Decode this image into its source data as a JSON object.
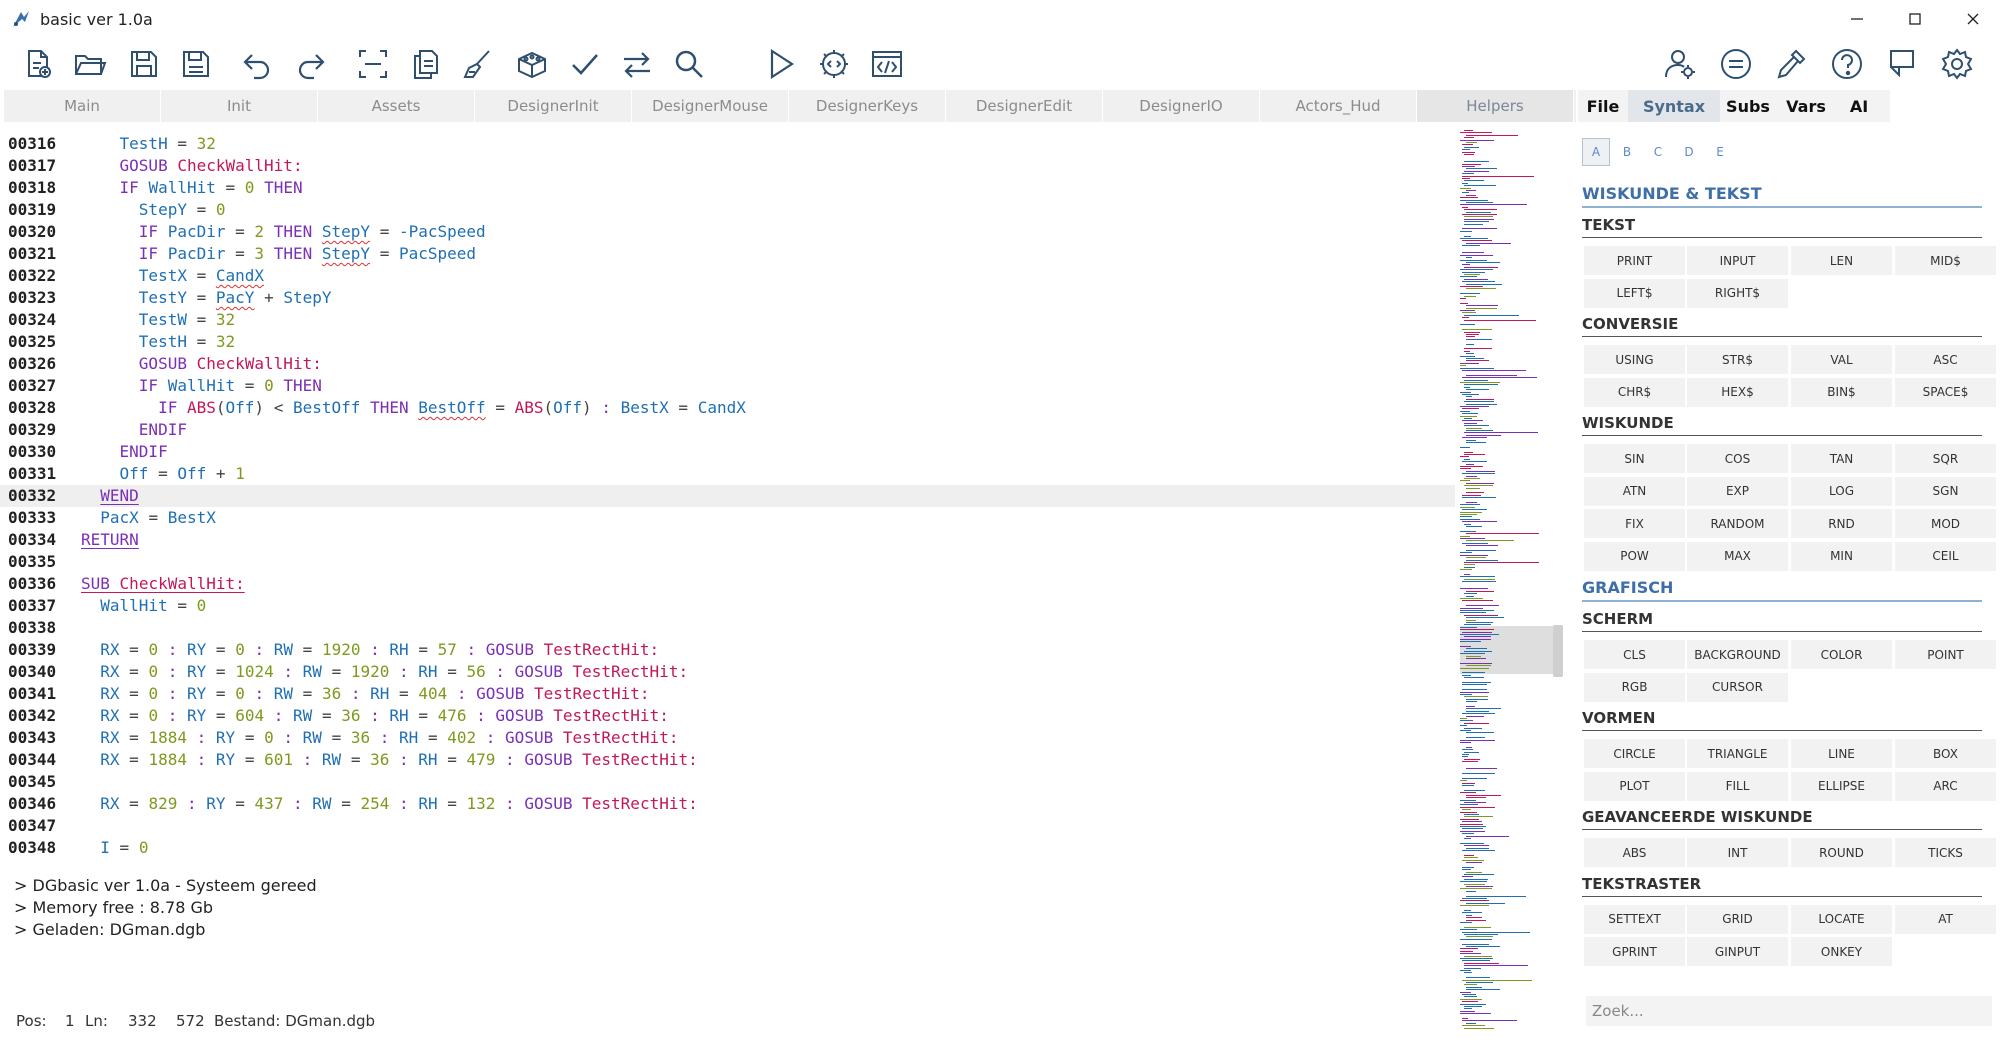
{
  "window": {
    "title": "basic ver 1.0a",
    "controls": [
      "minimize-icon",
      "maximize-icon",
      "close-icon"
    ]
  },
  "toolbar": {
    "buttons": [
      "new-file-icon",
      "open-folder-icon",
      "save-icon",
      "save-as-icon",
      "undo-icon",
      "redo-icon",
      "select-all-icon",
      "copy-icon",
      "brush-icon",
      "package-icon",
      "check-icon",
      "swap-icon",
      "search-icon",
      "run-icon",
      "compile-icon",
      "code-window-icon"
    ],
    "right_buttons": [
      "user-settings-icon",
      "equals-icon",
      "eyedropper-icon",
      "help-icon",
      "pin-icon",
      "gear-icon"
    ]
  },
  "tabs": [
    "Main",
    "Init",
    "Assets",
    "DesignerInit",
    "DesignerMouse",
    "DesignerKeys",
    "DesignerEdit",
    "DesignerIO",
    "Actors_Hud",
    "Helpers"
  ],
  "active_tab": "Helpers",
  "code": {
    "current_line": "00332",
    "lines": [
      {
        "n": "00316",
        "html": "    <span class='var'>TestH</span> <span class='op'>=</span> <span class='num'>32</span>"
      },
      {
        "n": "00317",
        "html": "    <span class='kw'>GOSUB</span> <span class='lbl'>CheckWallHit:</span>"
      },
      {
        "n": "00318",
        "html": "    <span class='kw'>IF</span> <span class='var'>WallHit</span> <span class='op'>=</span> <span class='num'>0</span> <span class='kw'>THEN</span>"
      },
      {
        "n": "00319",
        "html": "      <span class='var'>StepY</span> <span class='op'>=</span> <span class='num'>0</span>"
      },
      {
        "n": "00320",
        "html": "      <span class='kw'>IF</span> <span class='var'>PacDir</span> <span class='op'>=</span> <span class='num'>2</span> <span class='kw'>THEN</span> <span class='var sq'>StepY</span> <span class='op'>=</span> <span class='var'>-PacSpeed</span>"
      },
      {
        "n": "00321",
        "html": "      <span class='kw'>IF</span> <span class='var'>PacDir</span> <span class='op'>=</span> <span class='num'>3</span> <span class='kw'>THEN</span> <span class='var sq'>StepY</span> <span class='op'>=</span> <span class='var'>PacSpeed</span>"
      },
      {
        "n": "00322",
        "html": "      <span class='var'>TestX</span> <span class='op'>=</span> <span class='var sq'>CandX</span>"
      },
      {
        "n": "00323",
        "html": "      <span class='var'>TestY</span> <span class='op'>=</span> <span class='var sq'>PacY</span> <span class='op'>+</span> <span class='var'>StepY</span>"
      },
      {
        "n": "00324",
        "html": "      <span class='var'>TestW</span> <span class='op'>=</span> <span class='num'>32</span>"
      },
      {
        "n": "00325",
        "html": "      <span class='var'>TestH</span> <span class='op'>=</span> <span class='num'>32</span>"
      },
      {
        "n": "00326",
        "html": "      <span class='kw'>GOSUB</span> <span class='lbl'>CheckWallHit:</span>"
      },
      {
        "n": "00327",
        "html": "      <span class='kw'>IF</span> <span class='var'>WallHit</span> <span class='op'>=</span> <span class='num'>0</span> <span class='kw'>THEN</span>"
      },
      {
        "n": "00328",
        "html": "        <span class='kw'>IF</span> <span class='fn'>ABS</span><span class='op'>(</span><span class='var'>Off</span><span class='op'>)</span> <span class='op'>&lt;</span> <span class='var'>BestOff</span> <span class='kw'>THEN</span> <span class='var sq'>BestOff</span> <span class='op'>=</span> <span class='fn'>ABS</span><span class='op'>(</span><span class='var'>Off</span><span class='op'>)</span> <span class='kw'>:</span> <span class='var'>BestX</span> <span class='op'>=</span> <span class='var'>CandX</span>"
      },
      {
        "n": "00329",
        "html": "      <span class='kw'>ENDIF</span>"
      },
      {
        "n": "00330",
        "html": "    <span class='kw'>ENDIF</span>"
      },
      {
        "n": "00331",
        "html": "    <span class='var'>Off</span> <span class='op'>=</span> <span class='var'>Off</span> <span class='op'>+</span> <span class='num'>1</span>"
      },
      {
        "n": "00332",
        "html": "  <span class='kw ulk'>WEND</span>"
      },
      {
        "n": "00333",
        "html": "  <span class='var'>PacX</span> <span class='op'>=</span> <span class='var'>BestX</span>"
      },
      {
        "n": "00334",
        "html": "<span class='kw ulk'>RETURN</span>"
      },
      {
        "n": "00335",
        "html": ""
      },
      {
        "n": "00336",
        "html": "<span class='kw ul'>SUB</span><span class='ul'> </span><span class='lbl ul'>CheckWallHit:</span>"
      },
      {
        "n": "00337",
        "html": "  <span class='var'>WallHit</span> <span class='op'>=</span> <span class='num'>0</span>"
      },
      {
        "n": "00338",
        "html": ""
      },
      {
        "n": "00339",
        "html": "  <span class='var'>RX</span> <span class='op'>=</span> <span class='num'>0</span> <span class='kw'>:</span> <span class='var'>RY</span> <span class='op'>=</span> <span class='num'>0</span> <span class='kw'>:</span> <span class='var'>RW</span> <span class='op'>=</span> <span class='num'>1920</span> <span class='kw'>:</span> <span class='var'>RH</span> <span class='op'>=</span> <span class='num'>57</span> <span class='kw'>:</span> <span class='kw'>GOSUB</span> <span class='lbl'>TestRectHit:</span>"
      },
      {
        "n": "00340",
        "html": "  <span class='var'>RX</span> <span class='op'>=</span> <span class='num'>0</span> <span class='kw'>:</span> <span class='var'>RY</span> <span class='op'>=</span> <span class='num'>1024</span> <span class='kw'>:</span> <span class='var'>RW</span> <span class='op'>=</span> <span class='num'>1920</span> <span class='kw'>:</span> <span class='var'>RH</span> <span class='op'>=</span> <span class='num'>56</span> <span class='kw'>:</span> <span class='kw'>GOSUB</span> <span class='lbl'>TestRectHit:</span>"
      },
      {
        "n": "00341",
        "html": "  <span class='var'>RX</span> <span class='op'>=</span> <span class='num'>0</span> <span class='kw'>:</span> <span class='var'>RY</span> <span class='op'>=</span> <span class='num'>0</span> <span class='kw'>:</span> <span class='var'>RW</span> <span class='op'>=</span> <span class='num'>36</span> <span class='kw'>:</span> <span class='var'>RH</span> <span class='op'>=</span> <span class='num'>404</span> <span class='kw'>:</span> <span class='kw'>GOSUB</span> <span class='lbl'>TestRectHit:</span>"
      },
      {
        "n": "00342",
        "html": "  <span class='var'>RX</span> <span class='op'>=</span> <span class='num'>0</span> <span class='kw'>:</span> <span class='var'>RY</span> <span class='op'>=</span> <span class='num'>604</span> <span class='kw'>:</span> <span class='var'>RW</span> <span class='op'>=</span> <span class='num'>36</span> <span class='kw'>:</span> <span class='var'>RH</span> <span class='op'>=</span> <span class='num'>476</span> <span class='kw'>:</span> <span class='kw'>GOSUB</span> <span class='lbl'>TestRectHit:</span>"
      },
      {
        "n": "00343",
        "html": "  <span class='var'>RX</span> <span class='op'>=</span> <span class='num'>1884</span> <span class='kw'>:</span> <span class='var'>RY</span> <span class='op'>=</span> <span class='num'>0</span> <span class='kw'>:</span> <span class='var'>RW</span> <span class='op'>=</span> <span class='num'>36</span> <span class='kw'>:</span> <span class='var'>RH</span> <span class='op'>=</span> <span class='num'>402</span> <span class='kw'>:</span> <span class='kw'>GOSUB</span> <span class='lbl'>TestRectHit:</span>"
      },
      {
        "n": "00344",
        "html": "  <span class='var'>RX</span> <span class='op'>=</span> <span class='num'>1884</span> <span class='kw'>:</span> <span class='var'>RY</span> <span class='op'>=</span> <span class='num'>601</span> <span class='kw'>:</span> <span class='var'>RW</span> <span class='op'>=</span> <span class='num'>36</span> <span class='kw'>:</span> <span class='var'>RH</span> <span class='op'>=</span> <span class='num'>479</span> <span class='kw'>:</span> <span class='kw'>GOSUB</span> <span class='lbl'>TestRectHit:</span>"
      },
      {
        "n": "00345",
        "html": ""
      },
      {
        "n": "00346",
        "html": "  <span class='var'>RX</span> <span class='op'>=</span> <span class='num'>829</span> <span class='kw'>:</span> <span class='var'>RY</span> <span class='op'>=</span> <span class='num'>437</span> <span class='kw'>:</span> <span class='var'>RW</span> <span class='op'>=</span> <span class='num'>254</span> <span class='kw'>:</span> <span class='var'>RH</span> <span class='op'>=</span> <span class='num'>132</span> <span class='kw'>:</span> <span class='kw'>GOSUB</span> <span class='lbl'>TestRectHit:</span>"
      },
      {
        "n": "00347",
        "html": ""
      },
      {
        "n": "00348",
        "html": "  <span class='var'>I</span> <span class='op'>=</span> <span class='num'>0</span>"
      }
    ]
  },
  "console": {
    "lines": [
      "> DGbasic ver 1.0a - Systeem gereed",
      "> Memory free : 8.78 Gb",
      "> Geladen: DGman.dgb"
    ]
  },
  "status": {
    "pos_label": "Pos:",
    "pos_value": "1",
    "ln_label": "Ln:",
    "ln_value": "332",
    "total": "572",
    "file": "Bestand: DGman.dgb"
  },
  "panel": {
    "tabs": [
      "File",
      "Syntax",
      "Subs",
      "Vars",
      "AI"
    ],
    "active_tab": "Syntax",
    "letters": [
      "A",
      "B",
      "C",
      "D",
      "E"
    ],
    "active_letter": "A",
    "search_placeholder": "Zoek...",
    "sections": [
      {
        "title": "WISKUNDE & TEKST",
        "groups": [
          {
            "title": "TEKST",
            "items": [
              "PRINT",
              "INPUT",
              "LEN",
              "MID$",
              "LEFT$",
              "RIGHT$"
            ]
          },
          {
            "title": "CONVERSIE",
            "items": [
              "USING",
              "STR$",
              "VAL",
              "ASC",
              "CHR$",
              "HEX$",
              "BIN$",
              "SPACE$"
            ]
          },
          {
            "title": "WISKUNDE",
            "items": [
              "SIN",
              "COS",
              "TAN",
              "SQR",
              "ATN",
              "EXP",
              "LOG",
              "SGN",
              "FIX",
              "RANDOM",
              "RND",
              "MOD",
              "POW",
              "MAX",
              "MIN",
              "CEIL"
            ]
          }
        ]
      },
      {
        "title": "GRAFISCH",
        "groups": [
          {
            "title": "SCHERM",
            "items": [
              "CLS",
              "BACKGROUND",
              "COLOR",
              "POINT",
              "RGB",
              "CURSOR"
            ]
          },
          {
            "title": "VORMEN",
            "items": [
              "CIRCLE",
              "TRIANGLE",
              "LINE",
              "BOX",
              "PLOT",
              "FILL",
              "ELLIPSE",
              "ARC"
            ]
          },
          {
            "title": "GEAVANCEERDE WISKUNDE",
            "items": [
              "ABS",
              "INT",
              "ROUND",
              "TICKS"
            ]
          },
          {
            "title": "TEKSTRASTER",
            "items": [
              "SETTEXT",
              "GRID",
              "LOCATE",
              "AT",
              "GPRINT",
              "GINPUT",
              "ONKEY"
            ]
          }
        ]
      }
    ]
  },
  "colors": {
    "keyword": "#7b2fb7",
    "variable": "#1f6fb4",
    "number": "#7d9a1e",
    "label": "#c2185b",
    "accent": "#3f6fa6",
    "icon": "#2f4f6f"
  }
}
